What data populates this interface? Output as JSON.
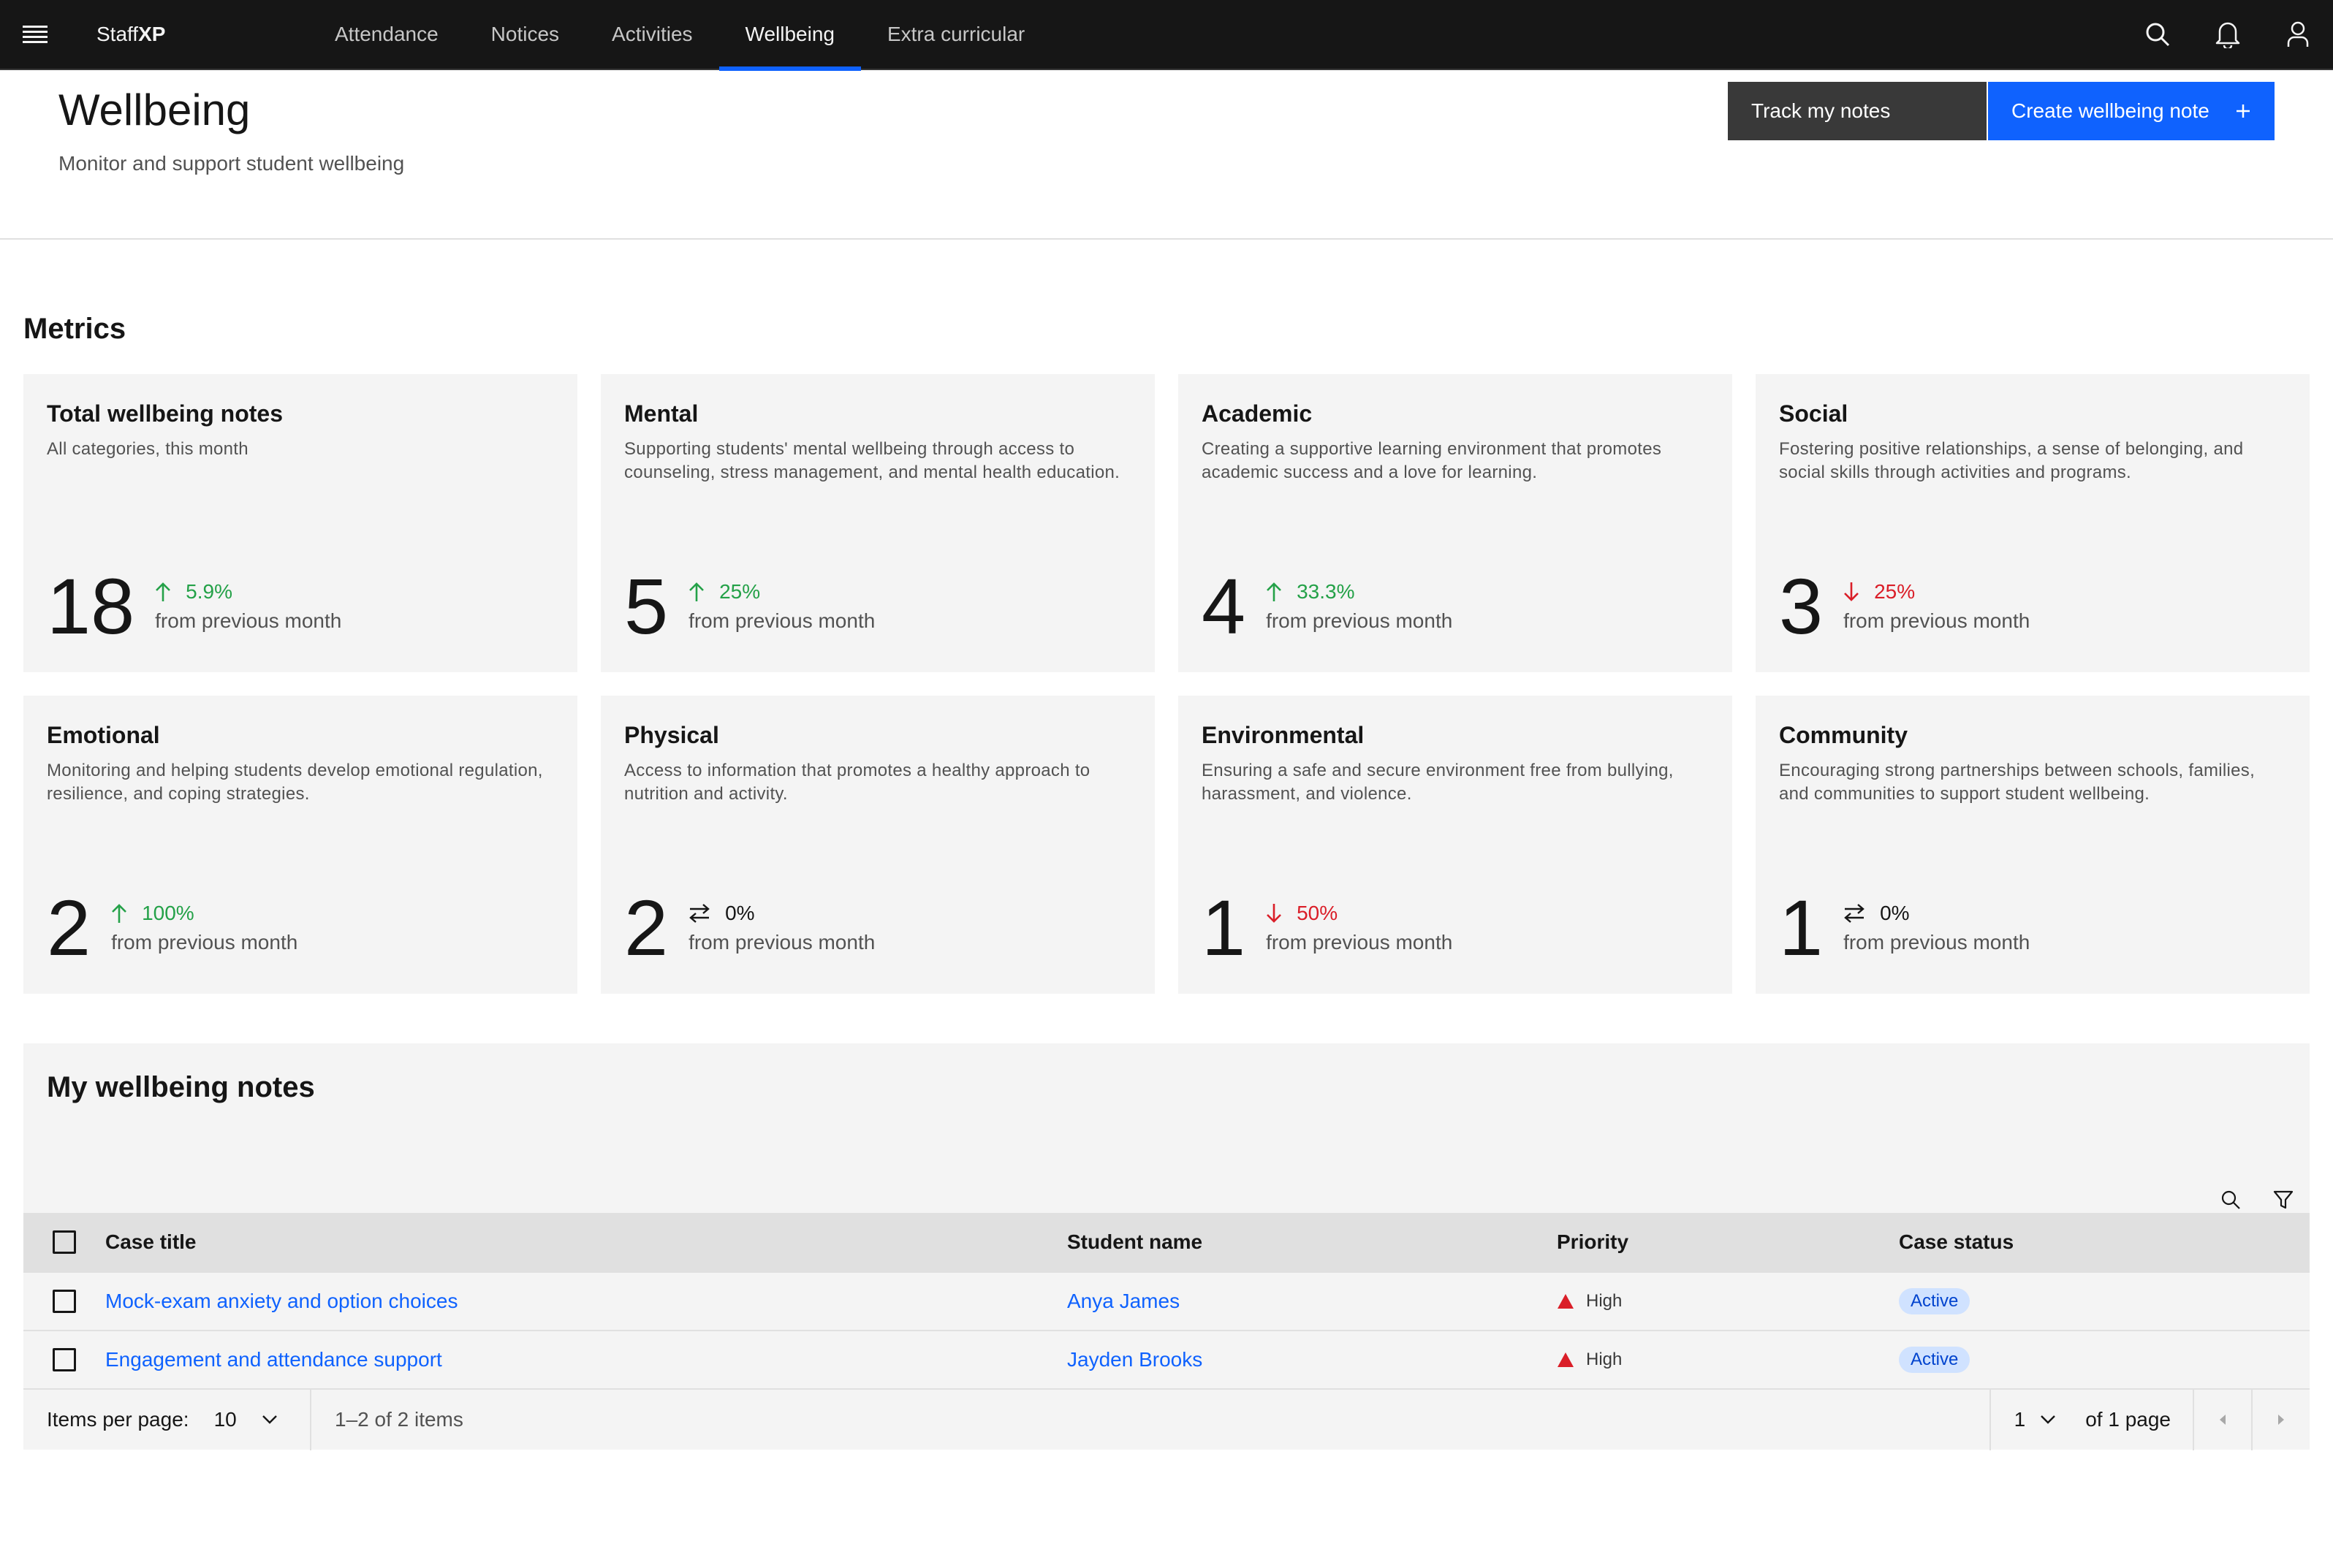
{
  "app": {
    "brand_prefix": "Staff",
    "brand_suffix": "XP"
  },
  "nav": {
    "items": [
      {
        "label": "Attendance"
      },
      {
        "label": "Notices"
      },
      {
        "label": "Activities"
      },
      {
        "label": "Wellbeing",
        "active": true
      },
      {
        "label": "Extra curricular"
      }
    ]
  },
  "header_icons": [
    "search-icon",
    "notification-icon",
    "user-icon"
  ],
  "page": {
    "title": "Wellbeing",
    "subtitle": "Monitor and support student wellbeing",
    "secondary_button": "Track my notes",
    "primary_button": "Create wellbeing note"
  },
  "metrics": {
    "title": "Metrics",
    "trend_suffix": "from previous month",
    "cards": [
      {
        "title": "Total wellbeing notes",
        "description": "All categories, this month",
        "value": "18",
        "trend": "5.9%",
        "direction": "up"
      },
      {
        "title": "Mental",
        "description": "Supporting students' mental wellbeing through access to counseling, stress management, and mental health education.",
        "value": "5",
        "trend": "25%",
        "direction": "up"
      },
      {
        "title": "Academic",
        "description": "Creating a supportive learning environment that promotes academic success and a love for learning.",
        "value": "4",
        "trend": "33.3%",
        "direction": "up"
      },
      {
        "title": "Social",
        "description": "Fostering positive relationships, a sense of belonging, and social skills through activities and programs.",
        "value": "3",
        "trend": "25%",
        "direction": "down"
      },
      {
        "title": "Emotional",
        "description": "Monitoring and helping students develop emotional regulation, resilience, and coping strategies.",
        "value": "2",
        "trend": "100%",
        "direction": "up"
      },
      {
        "title": "Physical",
        "description": "Access to information that promotes a healthy approach to nutrition and activity.",
        "value": "2",
        "trend": "0%",
        "direction": "flat"
      },
      {
        "title": "Environmental",
        "description": "Ensuring a safe and secure environment free from bullying, harassment, and violence.",
        "value": "1",
        "trend": "50%",
        "direction": "down"
      },
      {
        "title": "Community",
        "description": "Encouraging strong partnerships between schools, families, and communities to support student wellbeing.",
        "value": "1",
        "trend": "0%",
        "direction": "flat"
      }
    ]
  },
  "notes_table": {
    "title": "My wellbeing notes",
    "toolbar_icons": [
      "search-icon",
      "filter-icon"
    ],
    "columns": [
      "Case title",
      "Student name",
      "Priority",
      "Case status"
    ],
    "rows": [
      {
        "case_title": "Mock-exam anxiety and option choices",
        "student": "Anya James",
        "priority": "High",
        "status": "Active"
      },
      {
        "case_title": "Engagement and attendance support",
        "student": "Jayden Brooks",
        "priority": "High",
        "status": "Active"
      }
    ],
    "pagination": {
      "items_per_page_label": "Items per page:",
      "items_per_page": "10",
      "range": "1–2 of 2 items",
      "current_page": "1",
      "of_pages": "of 1 page"
    }
  },
  "colors": {
    "header_bg": "#161616",
    "accent": "#0f62fe",
    "trend_up": "#24a148",
    "trend_down": "#da1e28",
    "tag_bg": "#d0e2ff",
    "card_bg": "#f4f4f4"
  }
}
